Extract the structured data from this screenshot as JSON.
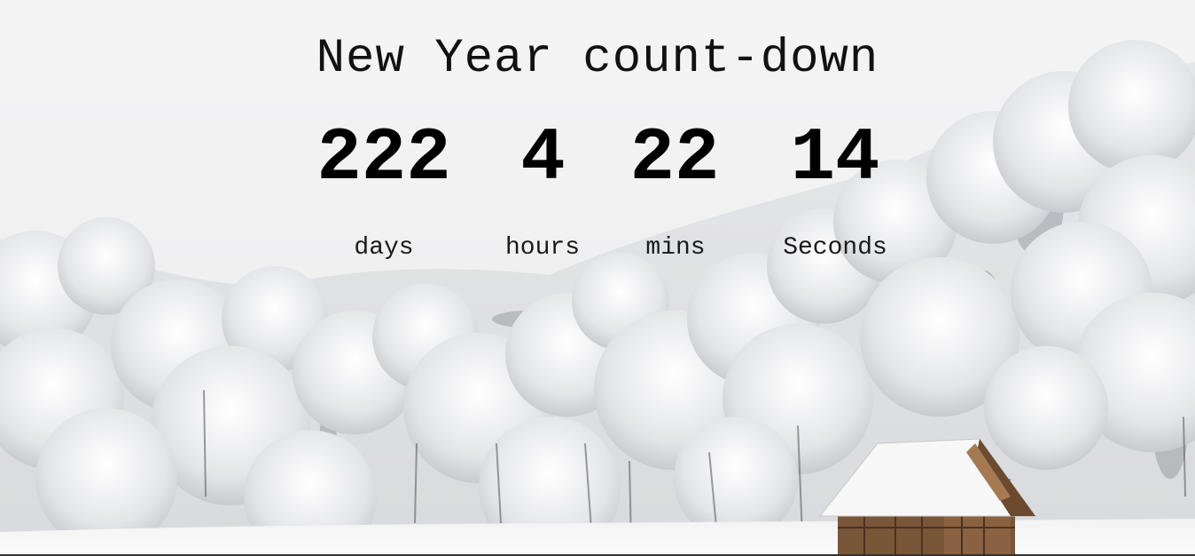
{
  "title": "New Year count-down",
  "countdown": {
    "days": "222",
    "hours": "4",
    "mins": "22",
    "seconds": "14"
  },
  "labels": {
    "days": "days",
    "hours": "hours",
    "mins": "mins",
    "seconds": "Seconds"
  },
  "colors": {
    "text": "#000000",
    "background": "#f2f2f3"
  }
}
